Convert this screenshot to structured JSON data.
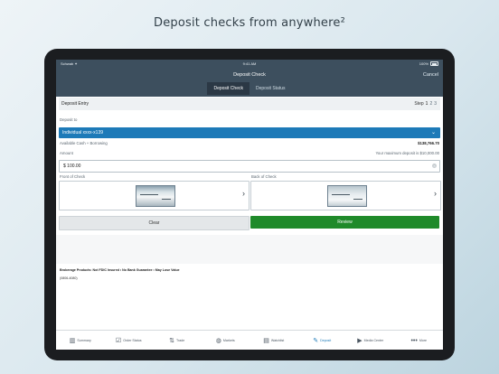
{
  "headline": "Deposit checks from anywhere²",
  "status_bar": {
    "carrier": "Schwab ✦",
    "time": "9:41 AM",
    "battery": "100%"
  },
  "nav": {
    "title": "Deposit Check",
    "cancel": "Cancel"
  },
  "segments": [
    {
      "label": "Deposit Check",
      "active": true
    },
    {
      "label": "Deposit Status",
      "active": false
    }
  ],
  "entry": {
    "title": "Deposit Entry",
    "step_label": "Step",
    "steps": [
      "1",
      "2",
      "3"
    ],
    "current_step": "1"
  },
  "deposit_to": {
    "label": "Deposit to",
    "account": "Individual xxxx-x139",
    "available_label": "Available Cash + Borrowing",
    "available_value": "$138,766.70"
  },
  "amount": {
    "label": "Amount",
    "max_note": "Your maximum deposit is $10,000.00",
    "value": "$ 100.00"
  },
  "front": {
    "label": "Front of Check"
  },
  "back": {
    "label": "Back of Check"
  },
  "buttons": {
    "clear": "Clear",
    "review": "Review"
  },
  "disclaimer": "Brokerage Products: Not FDIC Insured • No Bank Guarantee • May Lose Value",
  "code": "(0806-4080)",
  "tabs": [
    {
      "label": "Summary",
      "icon": "bar-chart-icon",
      "glyph": "▥"
    },
    {
      "label": "Order Status",
      "icon": "order-status-icon",
      "glyph": "☑"
    },
    {
      "label": "Trade",
      "icon": "trade-arrows-icon",
      "glyph": "⇅"
    },
    {
      "label": "Markets",
      "icon": "globe-icon",
      "glyph": "◍"
    },
    {
      "label": "Watchlist",
      "icon": "watchlist-icon",
      "glyph": "▤"
    },
    {
      "label": "Deposit",
      "icon": "deposit-check-icon",
      "glyph": "✎",
      "active": true
    },
    {
      "label": "Media Center",
      "icon": "media-play-icon",
      "glyph": "▶"
    },
    {
      "label": "More",
      "icon": "more-dots-icon",
      "glyph": "•••"
    }
  ],
  "colors": {
    "nav": "#3d4f5e",
    "account_select": "#1d7ab8",
    "review": "#1f8a2a"
  }
}
